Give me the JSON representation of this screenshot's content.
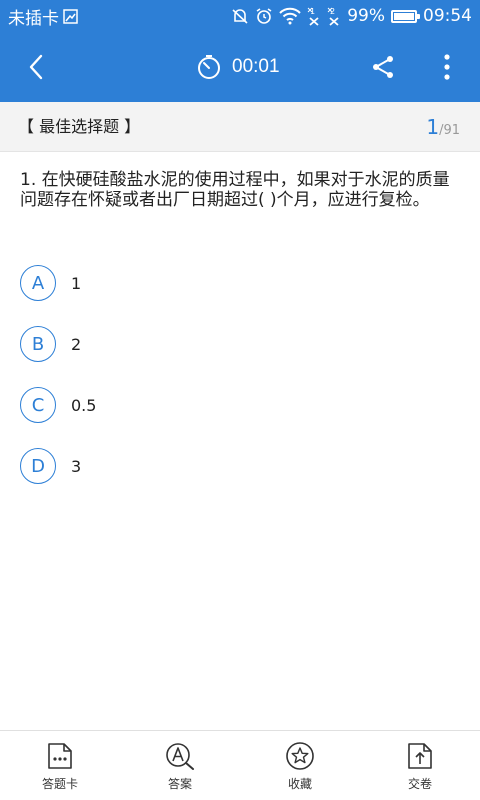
{
  "status_bar": {
    "carrier": "未插卡",
    "battery_percent": "99%",
    "battery_level": 0.99,
    "time": "09:54",
    "icons": [
      "sim-card-icon",
      "mute-icon",
      "alarm-icon",
      "wifi-icon",
      "signal-sim1-icon",
      "signal-sim2-icon",
      "battery-icon"
    ]
  },
  "app_bar": {
    "timer": "00:01",
    "icons": [
      "back-arrow-icon",
      "stopwatch-icon",
      "share-icon",
      "more-vertical-icon"
    ],
    "color": "#2d7fd6"
  },
  "question_header": {
    "type_label": "【 最佳选择题 】",
    "current": "1",
    "total": "/91"
  },
  "question": {
    "text": "1. 在快硬硅酸盐水泥的使用过程中，如果对于水泥的质量问题存在怀疑或者出厂日期超过(    )个月，应进行复检。",
    "options": [
      {
        "letter": "A",
        "text": "1"
      },
      {
        "letter": "B",
        "text": "2"
      },
      {
        "letter": "C",
        "text": "0.5"
      },
      {
        "letter": "D",
        "text": "3"
      }
    ]
  },
  "toolbar": {
    "answer_card_label": "答题卡",
    "answer_label": "答案",
    "favorite_label": "收藏",
    "submit_label": "交卷",
    "icons": [
      "answer-card-icon",
      "answer-search-icon",
      "star-icon",
      "submit-upload-icon"
    ]
  }
}
